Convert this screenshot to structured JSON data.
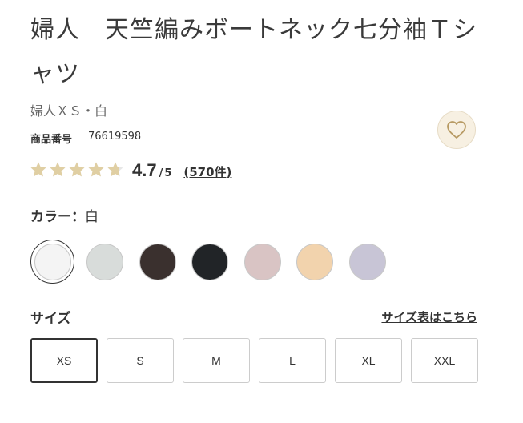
{
  "product": {
    "title": "婦人　天竺編みボートネック七分袖Ｔシャツ",
    "variant": "婦人ＸＳ・白",
    "number_label": "商品番号",
    "number": "76619598"
  },
  "rating": {
    "score": "4.7",
    "out_of": "5",
    "reviews": "(570件)",
    "stars_value": 4.7,
    "star_color": "#e0cfa3",
    "star_empty_color": "#e6e6e6"
  },
  "favorite": {
    "icon": "heart-icon",
    "bg": "#f7f0e2"
  },
  "color": {
    "label": "カラー：",
    "selected": "白",
    "swatches": [
      {
        "name": "白",
        "hex": "#f4f4f4",
        "selected": true
      },
      {
        "name": "ライトグレー",
        "hex": "#d8dcda",
        "selected": false
      },
      {
        "name": "ダークブラウン",
        "hex": "#3a302e",
        "selected": false
      },
      {
        "name": "ブラック",
        "hex": "#212427",
        "selected": false
      },
      {
        "name": "ピンク",
        "hex": "#d9c4c4",
        "selected": false
      },
      {
        "name": "ベージュ",
        "hex": "#f2d3ad",
        "selected": false
      },
      {
        "name": "ラベンダー",
        "hex": "#c8c5d6",
        "selected": false
      }
    ]
  },
  "size": {
    "label": "サイズ",
    "chart_link": "サイズ表はこちら",
    "options": [
      "XS",
      "S",
      "M",
      "L",
      "XL",
      "XXL"
    ],
    "selected": "XS"
  }
}
